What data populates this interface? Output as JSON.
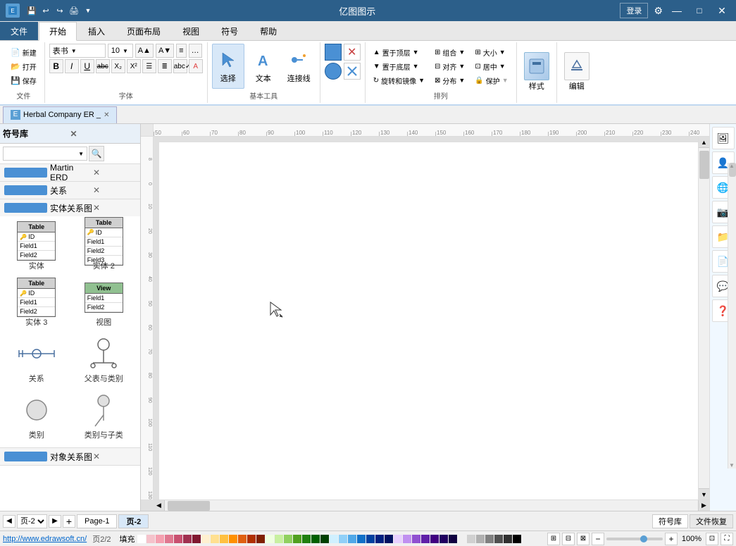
{
  "app": {
    "title": "亿图图示",
    "window_controls": [
      "—",
      "□",
      "×"
    ]
  },
  "title_bar": {
    "quick_access": [
      "undo",
      "redo",
      "save",
      "new"
    ],
    "title": "亿图图示"
  },
  "ribbon": {
    "tabs": [
      "文件",
      "开始",
      "插入",
      "页面布局",
      "视图",
      "符号",
      "帮助"
    ],
    "active_tab": "开始",
    "groups": [
      {
        "name": "文件",
        "label": "文件",
        "buttons": []
      },
      {
        "name": "字体",
        "label": "字体",
        "font_name": "表书",
        "font_size": "10",
        "buttons": [
          "B",
          "I",
          "U",
          "abc",
          "X₂",
          "X²"
        ]
      },
      {
        "name": "基本工具",
        "label": "基本工具",
        "buttons": [
          "选择",
          "文本",
          "连接线"
        ]
      },
      {
        "name": "排列",
        "label": "排列",
        "buttons": [
          "置于顶层",
          "置于底层",
          "旋转和镜像",
          "组合",
          "对齐",
          "分布",
          "大小",
          "居中",
          "保护"
        ]
      },
      {
        "name": "样式",
        "label": "样式"
      },
      {
        "name": "编辑",
        "label": "编辑"
      }
    ]
  },
  "doc_tabs": [
    {
      "label": "Herbal Company ER _",
      "active": true,
      "closable": true
    }
  ],
  "symbol_panel": {
    "title": "符号库",
    "search_placeholder": "",
    "sections": [
      {
        "name": "Martin ERD",
        "items": []
      },
      {
        "name": "关系",
        "items": []
      },
      {
        "name": "实体关系图",
        "items": [
          {
            "label": "实体",
            "type": "entity1"
          },
          {
            "label": "实体 2",
            "type": "entity2"
          },
          {
            "label": "实体 3",
            "type": "entity3"
          },
          {
            "label": "视图",
            "type": "view"
          },
          {
            "label": "关系",
            "type": "relation"
          },
          {
            "label": "父表与类别",
            "type": "parent_cat"
          },
          {
            "label": "类别",
            "type": "category"
          },
          {
            "label": "类别与子类",
            "type": "cat_sub"
          }
        ]
      },
      {
        "name": "对象关系图",
        "items": []
      }
    ]
  },
  "panel_tabs": [
    {
      "label": "符号库",
      "active": true
    },
    {
      "label": "文件恢复",
      "active": false
    }
  ],
  "canvas": {
    "bg": "white"
  },
  "right_panel_buttons": [
    "🔍",
    "🏃",
    "🌐",
    "📋",
    "🔧",
    "💬",
    "❓"
  ],
  "ruler": {
    "h_ticks": [
      "50",
      "60",
      "70",
      "80",
      "90",
      "100",
      "110",
      "120",
      "130",
      "140",
      "150",
      "160",
      "170",
      "180",
      "190",
      "200",
      "210",
      "220",
      "230",
      "240"
    ],
    "v_ticks": [
      "8",
      "0",
      "8",
      "10",
      "20",
      "30",
      "40",
      "50",
      "60",
      "70",
      "80",
      "90",
      "100",
      "110",
      "120",
      "130"
    ]
  },
  "page_nav": {
    "prev_label": "◀",
    "next_label": "▶",
    "add_label": "+",
    "tabs": [
      {
        "label": "Page-1",
        "active": false
      },
      {
        "label": "页-2",
        "active": true
      }
    ],
    "page_info": "页-2",
    "page_total": "页2/2"
  },
  "status_bar": {
    "url": "http://www.edrawsoft.cn/",
    "page_info": "页2/2",
    "zoom": "100%",
    "fill_label": "填充"
  },
  "colors": [
    "#ffffff",
    "#f5c2cb",
    "#f5a0b0",
    "#e07890",
    "#c85070",
    "#a03050",
    "#801830",
    "#fff0d0",
    "#ffe090",
    "#ffc040",
    "#ff9000",
    "#e06010",
    "#b03000",
    "#802000",
    "#f0ffe0",
    "#c8f0a0",
    "#90d060",
    "#50a020",
    "#208010",
    "#006000",
    "#004000",
    "#d0f0ff",
    "#90d0f8",
    "#50a8e8",
    "#1070c8",
    "#0040a0",
    "#002080",
    "#001060",
    "#e8d0ff",
    "#c090f0",
    "#9050d0",
    "#6020a8",
    "#400080",
    "#200060",
    "#100040",
    "#f0f0f0",
    "#d0d0d0",
    "#b0b0b0",
    "#808080",
    "#505050",
    "#303030",
    "#000000"
  ]
}
